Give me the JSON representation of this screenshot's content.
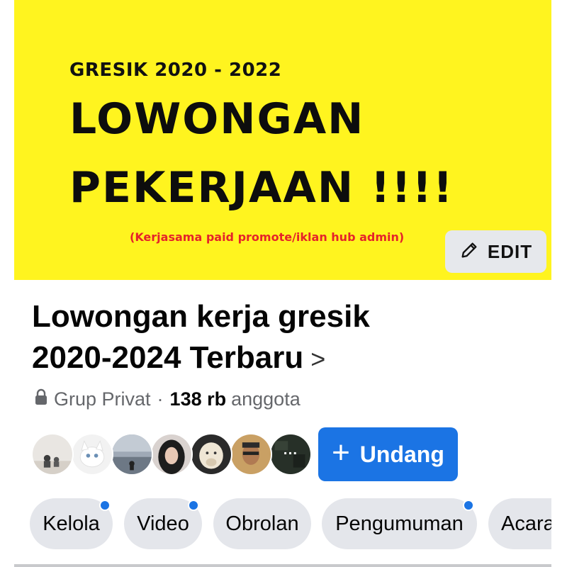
{
  "cover": {
    "line_year": "GRESIK 2020 - 2022",
    "line_title1": "LOWONGAN",
    "line_title2": "PEKERJAAN !!!!",
    "note": "(Kerjasama paid promote/iklan hub admin)",
    "edit_label": "EDIT",
    "background_color": "#fff41f"
  },
  "group": {
    "name_line1": "Lowongan kerja gresik",
    "name_line2": "2020-2024 Terbaru",
    "chevron": ">",
    "privacy": "Grup Privat",
    "separator": "·",
    "member_count": "138 rb",
    "member_label": "anggota"
  },
  "members": {
    "more_glyph": "···",
    "avatars": [
      "avatar-1",
      "avatar-2",
      "avatar-3",
      "avatar-4",
      "avatar-5",
      "avatar-6",
      "avatar-more"
    ]
  },
  "invite": {
    "plus": "+",
    "label": "Undang",
    "color": "#1b74e4"
  },
  "tabs": [
    {
      "label": "Kelola",
      "has_dot": true
    },
    {
      "label": "Video",
      "has_dot": true
    },
    {
      "label": "Obrolan",
      "has_dot": false
    },
    {
      "label": "Pengumuman",
      "has_dot": true
    },
    {
      "label": "Acara",
      "has_dot": false
    }
  ]
}
